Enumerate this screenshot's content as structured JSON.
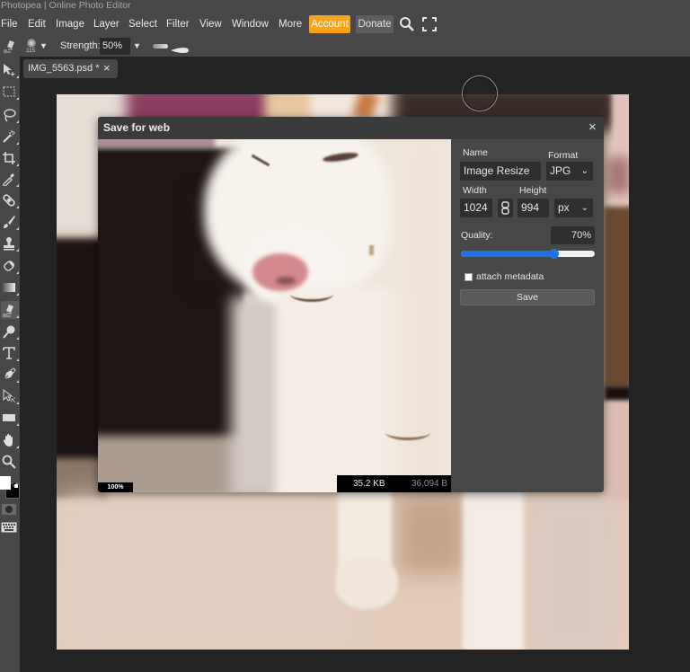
{
  "app": {
    "window_title": "Photopea | Online Photo Editor"
  },
  "menu": {
    "items": [
      "File",
      "Edit",
      "Image",
      "Layer",
      "Select",
      "Filter",
      "View",
      "Window",
      "More"
    ],
    "account_label": "Account",
    "donate_label": "Donate",
    "icons": [
      "search-icon",
      "fullscreen-icon"
    ]
  },
  "options_bar": {
    "active_tool_icon": "smudge-tool-icon",
    "brush_size": "115",
    "strength_label": "Strength:",
    "strength_value": "50%"
  },
  "toolbar": {
    "tools": [
      "move",
      "marquee",
      "lasso",
      "magic-wand",
      "crop",
      "eyedropper",
      "healing",
      "brush",
      "clone-stamp",
      "eraser",
      "gradient",
      "smudge",
      "dodge",
      "text",
      "pen",
      "path-select",
      "shape",
      "hand",
      "zoom"
    ],
    "foreground_color": "#ffffff",
    "background_color": "#000000"
  },
  "document_tab": {
    "label": "IMG_5563.psd *"
  },
  "dialog": {
    "title": "Save for web",
    "preview": {
      "zoom": "100%",
      "file_size_kb": "35.2 KB",
      "file_size_bytes": "36,094 B"
    },
    "name_label": "Name",
    "name_value": "Image Resize",
    "format_label": "Format",
    "format_value": "JPG",
    "width_label": "Width",
    "width_value": "1024",
    "height_label": "Height",
    "height_value": "994",
    "unit_value": "px",
    "quality_label": "Quality:",
    "quality_value": "70%",
    "quality_percent": 70,
    "metadata_label": "attach metadata",
    "metadata_checked": false,
    "save_label": "Save"
  },
  "colors": {
    "account_button": "#f9a11b",
    "slider_accent": "#1e74e6",
    "panel": "#474747",
    "workspace": "#232323"
  }
}
